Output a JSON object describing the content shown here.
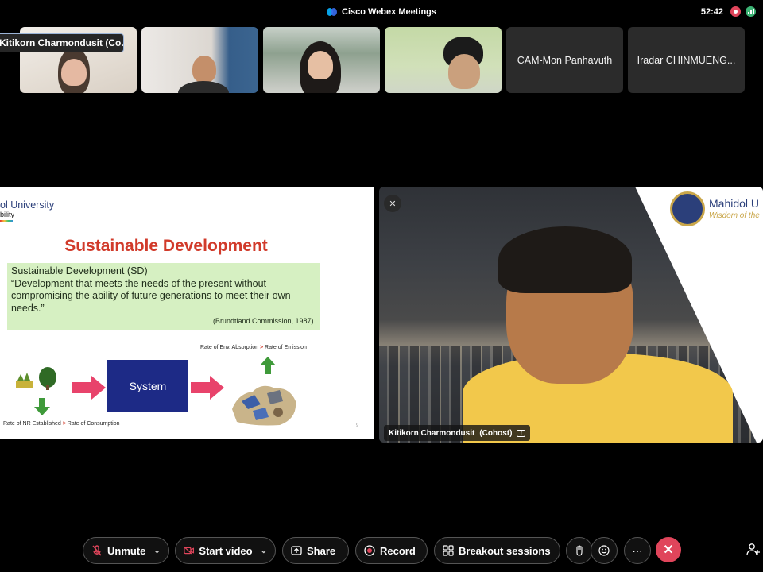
{
  "window": {
    "title": "Cisco Webex Meetings",
    "timer": "52:42"
  },
  "participants": [
    {
      "name": "Kitikorn Charmondusit (Co...",
      "video": true
    },
    {
      "name": "",
      "video": true
    },
    {
      "name": "",
      "video": true
    },
    {
      "name": "",
      "video": true
    },
    {
      "name": "CAM-Mon Panhavuth",
      "video": false
    },
    {
      "name": "Iradar CHINMUENG...",
      "video": false
    }
  ],
  "slide": {
    "brand": "ol University",
    "brand_sub": "bility",
    "title": "Sustainable Development",
    "definition_heading": "Sustainable Development (SD)",
    "definition_quote": "“Development that meets the needs of the present without compromising the ability of future generations to meet their own needs.”",
    "citation": "(Brundtland Commission, 1987).",
    "rate_top_left": "Rate of Env. Absorption",
    "rate_top_gt": ">",
    "rate_top_right": "Rate of Emission",
    "rate_bottom_left": "Rate of NR Established",
    "rate_bottom_gt": ">",
    "rate_bottom_right": "Rate of Consumption",
    "system_label": "System",
    "page_number": "9"
  },
  "speaker": {
    "name": "Kitikorn Charmondusit",
    "role": "(Cohost)",
    "logo_text": "Mahidol U",
    "logo_sub": "Wisdom of the"
  },
  "toolbar": {
    "unmute_label": "Unmute",
    "start_video_label": "Start video",
    "share_label": "Share",
    "record_label": "Record",
    "breakout_label": "Breakout sessions",
    "more_label": "···"
  },
  "icons": {
    "mic": "mic-muted-icon",
    "video": "video-off-icon",
    "share": "share-icon",
    "record": "record-icon",
    "breakout": "breakout-icon",
    "raise_hand": "raise-hand-icon",
    "reactions": "reactions-icon",
    "end": "end-call-icon",
    "participants": "participants-icon"
  },
  "colors": {
    "end_call": "#e0455b",
    "slide_title": "#d13a2a",
    "system_box": "#1d2a86",
    "definition_bg": "#d6f0c2",
    "arrow_pink": "#e8436b",
    "arrow_green": "#3f9a3a"
  }
}
